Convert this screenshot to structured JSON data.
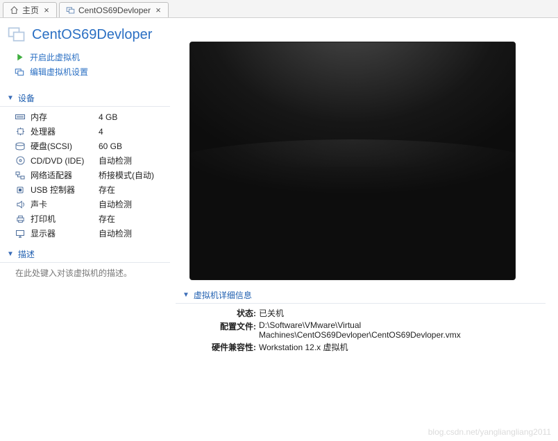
{
  "tabs": [
    {
      "label": "主页"
    },
    {
      "label": "CentOS69Devloper"
    }
  ],
  "title": "CentOS69Devloper",
  "actions": {
    "power_on": "开启此虚拟机",
    "edit_settings": "编辑虚拟机设置"
  },
  "sections": {
    "devices_header": "设备",
    "description_header": "描述",
    "details_header": "虚拟机详细信息"
  },
  "devices": [
    {
      "icon": "memory",
      "name": "内存",
      "value": "4 GB"
    },
    {
      "icon": "cpu",
      "name": "处理器",
      "value": "4"
    },
    {
      "icon": "disk",
      "name": "硬盘(SCSI)",
      "value": "60 GB"
    },
    {
      "icon": "disc",
      "name": "CD/DVD (IDE)",
      "value": "自动检测"
    },
    {
      "icon": "net",
      "name": "网络适配器",
      "value": "桥接模式(自动)"
    },
    {
      "icon": "usb",
      "name": "USB 控制器",
      "value": "存在"
    },
    {
      "icon": "sound",
      "name": "声卡",
      "value": "自动检测"
    },
    {
      "icon": "printer",
      "name": "打印机",
      "value": "存在"
    },
    {
      "icon": "display",
      "name": "显示器",
      "value": "自动检测"
    }
  ],
  "description_placeholder": "在此处键入对该虚拟机的描述。",
  "details": {
    "state_k": "状态:",
    "state_v": "已关机",
    "config_k": "配置文件:",
    "config_v": "D:\\Software\\VMware\\Virtual Machines\\CentOS69Devloper\\CentOS69Devloper.vmx",
    "compat_k": "硬件兼容性:",
    "compat_v": "Workstation 12.x 虚拟机"
  },
  "watermark": "blog.csdn.net/yangliangliang2011"
}
